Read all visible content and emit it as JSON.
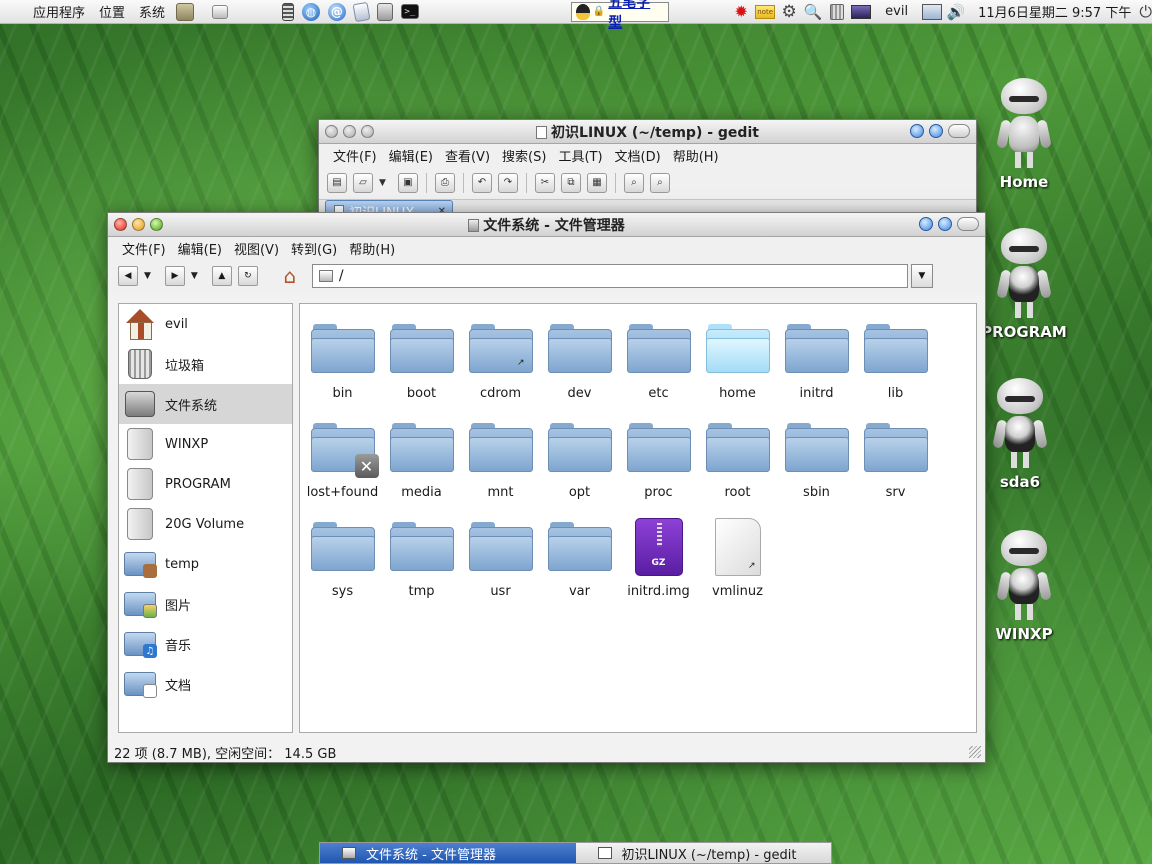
{
  "top_panel": {
    "menus": [
      "应用程序",
      "位置",
      "系统"
    ],
    "launchers": [
      "folder-icon",
      "drive-icon",
      "calculator-icon",
      "globe-icon",
      "mail-icon",
      "note-icon",
      "package-icon",
      "terminal-icon"
    ],
    "input_method_label": "五笔字型",
    "user": "evil",
    "clock": "11月6日星期二  9:57 下午"
  },
  "desktop_icons": [
    "Home",
    "PROGRAM",
    "sda6",
    "WINXP"
  ],
  "gedit": {
    "title": "初识LINUX (~/temp) - gedit",
    "menus": [
      "文件(F)",
      "编辑(E)",
      "查看(V)",
      "搜索(S)",
      "工具(T)",
      "文档(D)",
      "帮助(H)"
    ],
    "tab_label": "初识LINUX"
  },
  "nautilus": {
    "title": "文件系统 - 文件管理器",
    "menus": [
      "文件(F)",
      "编辑(E)",
      "视图(V)",
      "转到(G)",
      "帮助(H)"
    ],
    "location": "/",
    "sidebar": [
      {
        "label": "evil",
        "icon": "home-icon"
      },
      {
        "label": "垃圾箱",
        "icon": "trash-icon"
      },
      {
        "label": "文件系统",
        "icon": "harddisk-icon",
        "selected": true
      },
      {
        "label": "WINXP",
        "icon": "disk-icon"
      },
      {
        "label": "PROGRAM",
        "icon": "disk-icon"
      },
      {
        "label": "20G Volume",
        "icon": "disk-icon"
      },
      {
        "label": "temp",
        "icon": "folder-icon"
      },
      {
        "label": "图片",
        "icon": "pictures-folder-icon"
      },
      {
        "label": "音乐",
        "icon": "music-folder-icon"
      },
      {
        "label": "文档",
        "icon": "documents-folder-icon"
      }
    ],
    "items": [
      {
        "name": "bin",
        "type": "folder"
      },
      {
        "name": "boot",
        "type": "folder"
      },
      {
        "name": "cdrom",
        "type": "folder-link"
      },
      {
        "name": "dev",
        "type": "folder"
      },
      {
        "name": "etc",
        "type": "folder"
      },
      {
        "name": "home",
        "type": "folder-light"
      },
      {
        "name": "initrd",
        "type": "folder"
      },
      {
        "name": "lib",
        "type": "folder"
      },
      {
        "name": "lost+found",
        "type": "folder-locked"
      },
      {
        "name": "media",
        "type": "folder"
      },
      {
        "name": "mnt",
        "type": "folder"
      },
      {
        "name": "opt",
        "type": "folder"
      },
      {
        "name": "proc",
        "type": "folder"
      },
      {
        "name": "root",
        "type": "folder"
      },
      {
        "name": "sbin",
        "type": "folder"
      },
      {
        "name": "srv",
        "type": "folder"
      },
      {
        "name": "sys",
        "type": "folder"
      },
      {
        "name": "tmp",
        "type": "folder"
      },
      {
        "name": "usr",
        "type": "folder"
      },
      {
        "name": "var",
        "type": "folder"
      },
      {
        "name": "initrd.img",
        "type": "archive"
      },
      {
        "name": "vmlinuz",
        "type": "file-link"
      }
    ],
    "status": "22 项 (8.7 MB), 空闲空间： 14.5 GB"
  },
  "taskbar": [
    "文件系统 - 文件管理器",
    "初识LINUX (~/temp) - gedit"
  ],
  "colors": {
    "accent": "#2b62b8",
    "folder": "#7ea5cf",
    "archive": "#6a2bb8"
  }
}
